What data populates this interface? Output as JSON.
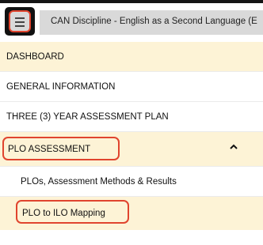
{
  "header": {
    "title": "CAN Discipline - English as a Second Language (E"
  },
  "nav": {
    "dashboard": "DASHBOARD",
    "general_information": "GENERAL INFORMATION",
    "assessment_plan": "THREE (3) YEAR ASSESSMENT PLAN",
    "plo_assessment": "PLO ASSESSMENT",
    "plo_methods": "PLOs, Assessment Methods & Results",
    "plo_ilo_mapping": "PLO to ILO Mapping"
  },
  "icons": {
    "menu": "hamburger-menu-icon",
    "expand": "chevron-up-icon"
  },
  "colors": {
    "highlight": "#fdf3d6",
    "annotation": "#e0442e",
    "title_bar": "#d9d9d9"
  }
}
